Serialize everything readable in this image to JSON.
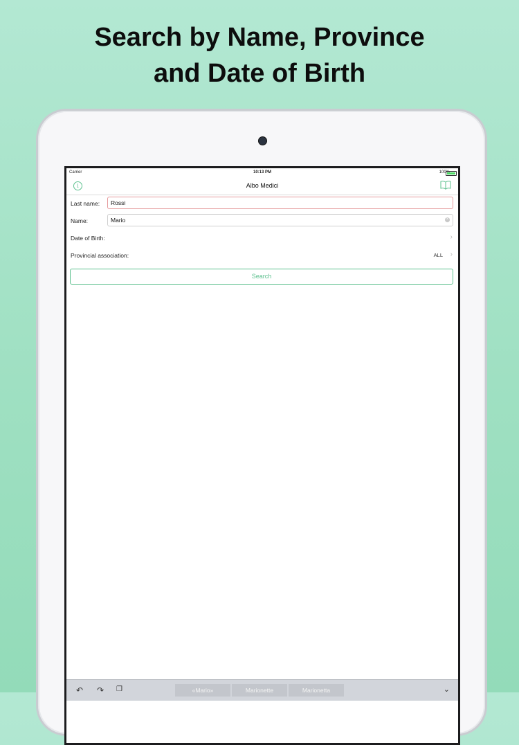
{
  "headline": {
    "line1": "Search by Name, Province",
    "line2": "and Date of Birth"
  },
  "status": {
    "carrier": "Carrier",
    "time": "10:13 PM",
    "battery": "100%"
  },
  "navbar": {
    "title": "Albo Medici",
    "left_icon": "info-icon",
    "right_icon": "book-icon"
  },
  "form": {
    "last_name_label": "Last name:",
    "last_name_value": "Rossi",
    "name_label": "Name:",
    "name_value": "Mario",
    "dob_label": "Date of Birth:",
    "province_label": "Provincial association:",
    "province_value": "ALL",
    "search_label": "Search"
  },
  "keyboard": {
    "suggestions": [
      "«Mario»",
      "Marionette",
      "Marionetta"
    ]
  },
  "colors": {
    "accent": "#5cc08e",
    "background": "#a6e3c7",
    "active_field_border": "#e5989b"
  }
}
